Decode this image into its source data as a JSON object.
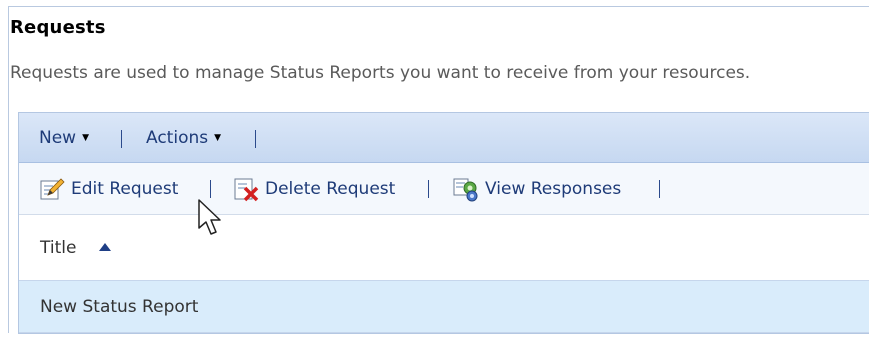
{
  "section": {
    "title": "Requests",
    "description": "Requests are used to manage Status Reports you want to receive from your resources."
  },
  "toolbar": {
    "new_label": "New",
    "actions_label": "Actions"
  },
  "item_toolbar": {
    "edit_label": "Edit Request",
    "delete_label": "Delete Request",
    "view_label": "View Responses"
  },
  "table": {
    "column_title": "Title",
    "sort_direction": "ascending",
    "rows": [
      "New Status Report"
    ]
  },
  "colors": {
    "link": "#1e3b78",
    "row_selected": "#d9ecfb",
    "toolbar": "#c6d8f1"
  }
}
